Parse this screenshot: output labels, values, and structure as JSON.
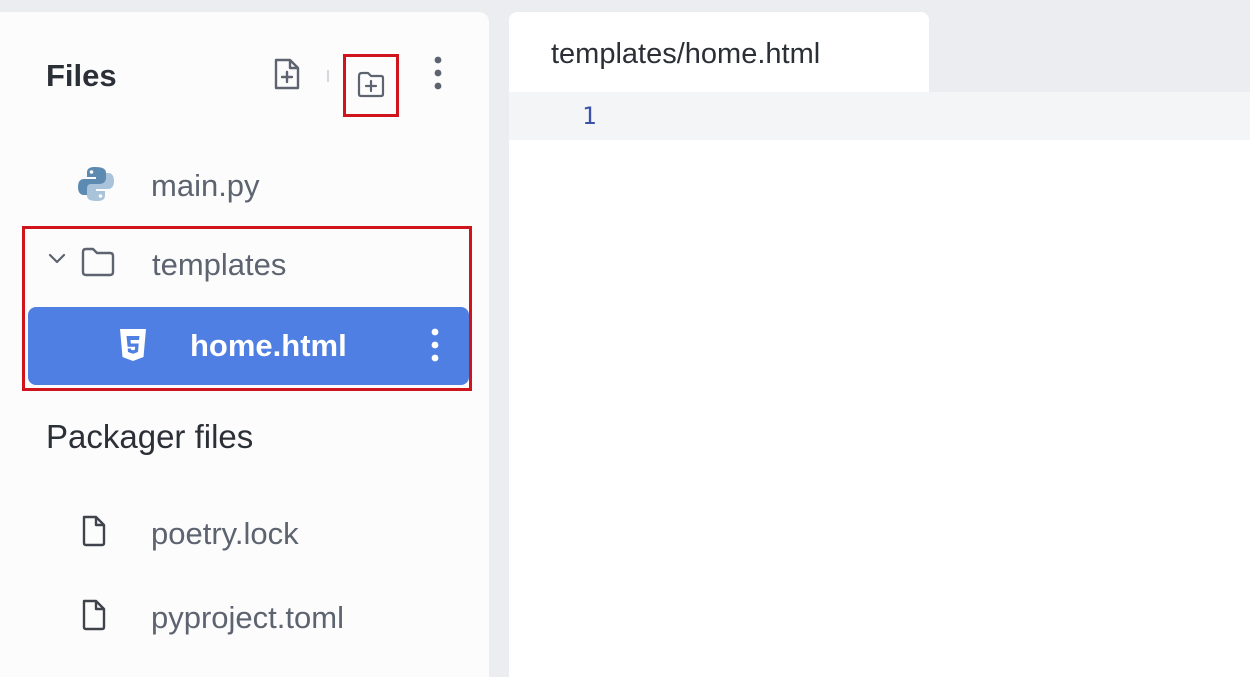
{
  "sidebar": {
    "title": "Files",
    "files": [
      {
        "name": "main.py",
        "icon": "python-icon"
      },
      {
        "name": "templates",
        "icon": "folder-icon",
        "expanded": true
      },
      {
        "name": "home.html",
        "icon": "html5-icon",
        "selected": true
      }
    ],
    "packager_title": "Packager files",
    "packager_files": [
      {
        "name": "poetry.lock",
        "icon": "file-icon"
      },
      {
        "name": "pyproject.toml",
        "icon": "file-icon"
      }
    ]
  },
  "editor": {
    "tab_label": "templates/home.html",
    "line_numbers": [
      "1"
    ]
  },
  "colors": {
    "selection": "#4f7fe2",
    "highlight_annotation": "#d0141c",
    "line_number": "#3c52a8"
  }
}
